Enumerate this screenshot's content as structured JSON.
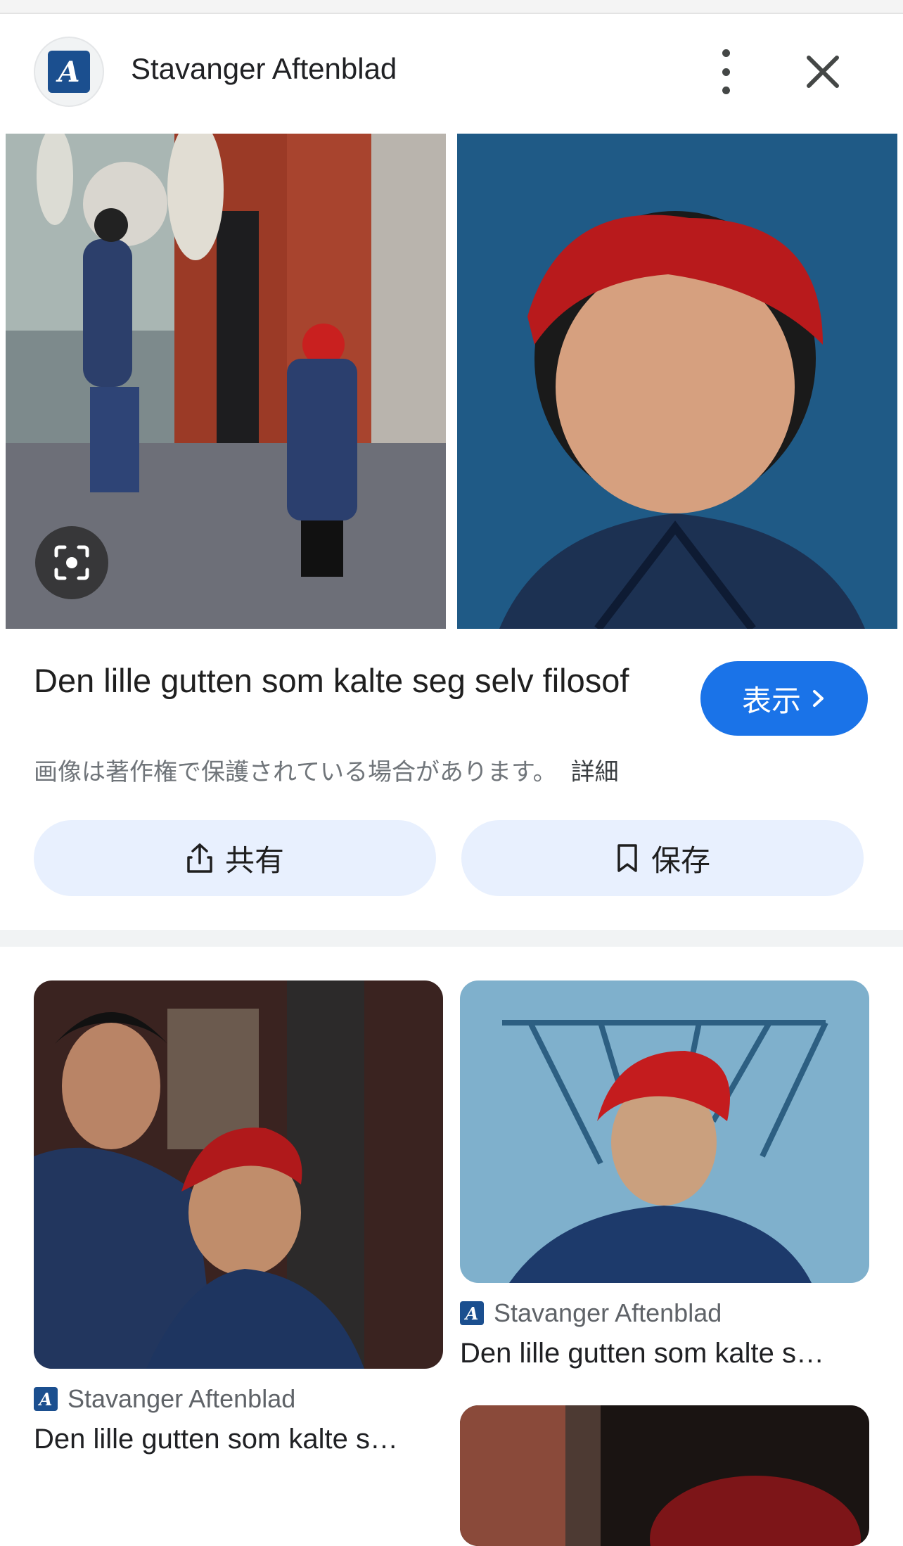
{
  "header": {
    "logo_letter": "A",
    "source_name": "Stavanger Aftenblad",
    "more_icon": "more-vert-icon",
    "close_icon": "close-icon"
  },
  "colors": {
    "accent": "#1a73e8",
    "button_bg": "#e8f0fe",
    "brand": "#1b4f8f"
  },
  "result": {
    "title": "Den lille gutten som kalte seg selv filosof",
    "view_label": "表示",
    "copyright_notice": "画像は著作権で保護されている場合があります。",
    "detail_link": "詳細",
    "share_label": "共有",
    "save_label": "保存"
  },
  "related": [
    {
      "source": "Stavanger Aftenblad",
      "title": "Den lille gutten som kalte s…"
    },
    {
      "source": "Stavanger Aftenblad",
      "title": "Den lille gutten som kalte s…"
    }
  ]
}
